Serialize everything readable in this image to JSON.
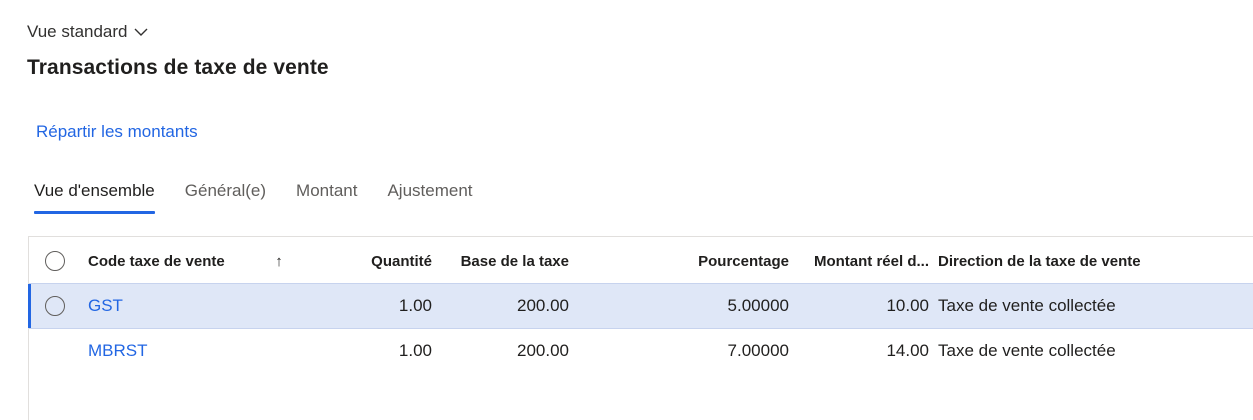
{
  "view": {
    "label": "Vue standard",
    "chevron_icon": "chevron-down-icon"
  },
  "page": {
    "title": "Transactions de taxe de vente"
  },
  "actions": {
    "distribute_amounts": "Répartir les montants"
  },
  "tabs": [
    {
      "label": "Vue d'ensemble",
      "active": true
    },
    {
      "label": "Général(e)",
      "active": false
    },
    {
      "label": "Montant",
      "active": false
    },
    {
      "label": "Ajustement",
      "active": false
    }
  ],
  "grid": {
    "columns": {
      "code": "Code taxe de vente",
      "sort_indicator": "↑",
      "quantity": "Quantité",
      "base": "Base de la taxe",
      "percentage": "Pourcentage",
      "actual_amount": "Montant réel d...",
      "direction": "Direction de la taxe de vente"
    },
    "rows": [
      {
        "code": "GST",
        "quantity": "1.00",
        "base": "200.00",
        "percentage": "5.00000",
        "actual_amount": "10.00",
        "direction": "Taxe de vente collectée",
        "selected": true
      },
      {
        "code": "MBRST",
        "quantity": "1.00",
        "base": "200.00",
        "percentage": "7.00000",
        "actual_amount": "14.00",
        "direction": "Taxe de vente collectée",
        "selected": false
      }
    ]
  },
  "colors": {
    "accent": "#2266e3",
    "selected_row": "#dfe7f7",
    "text": "#201f1e",
    "muted": "#605e5c"
  }
}
